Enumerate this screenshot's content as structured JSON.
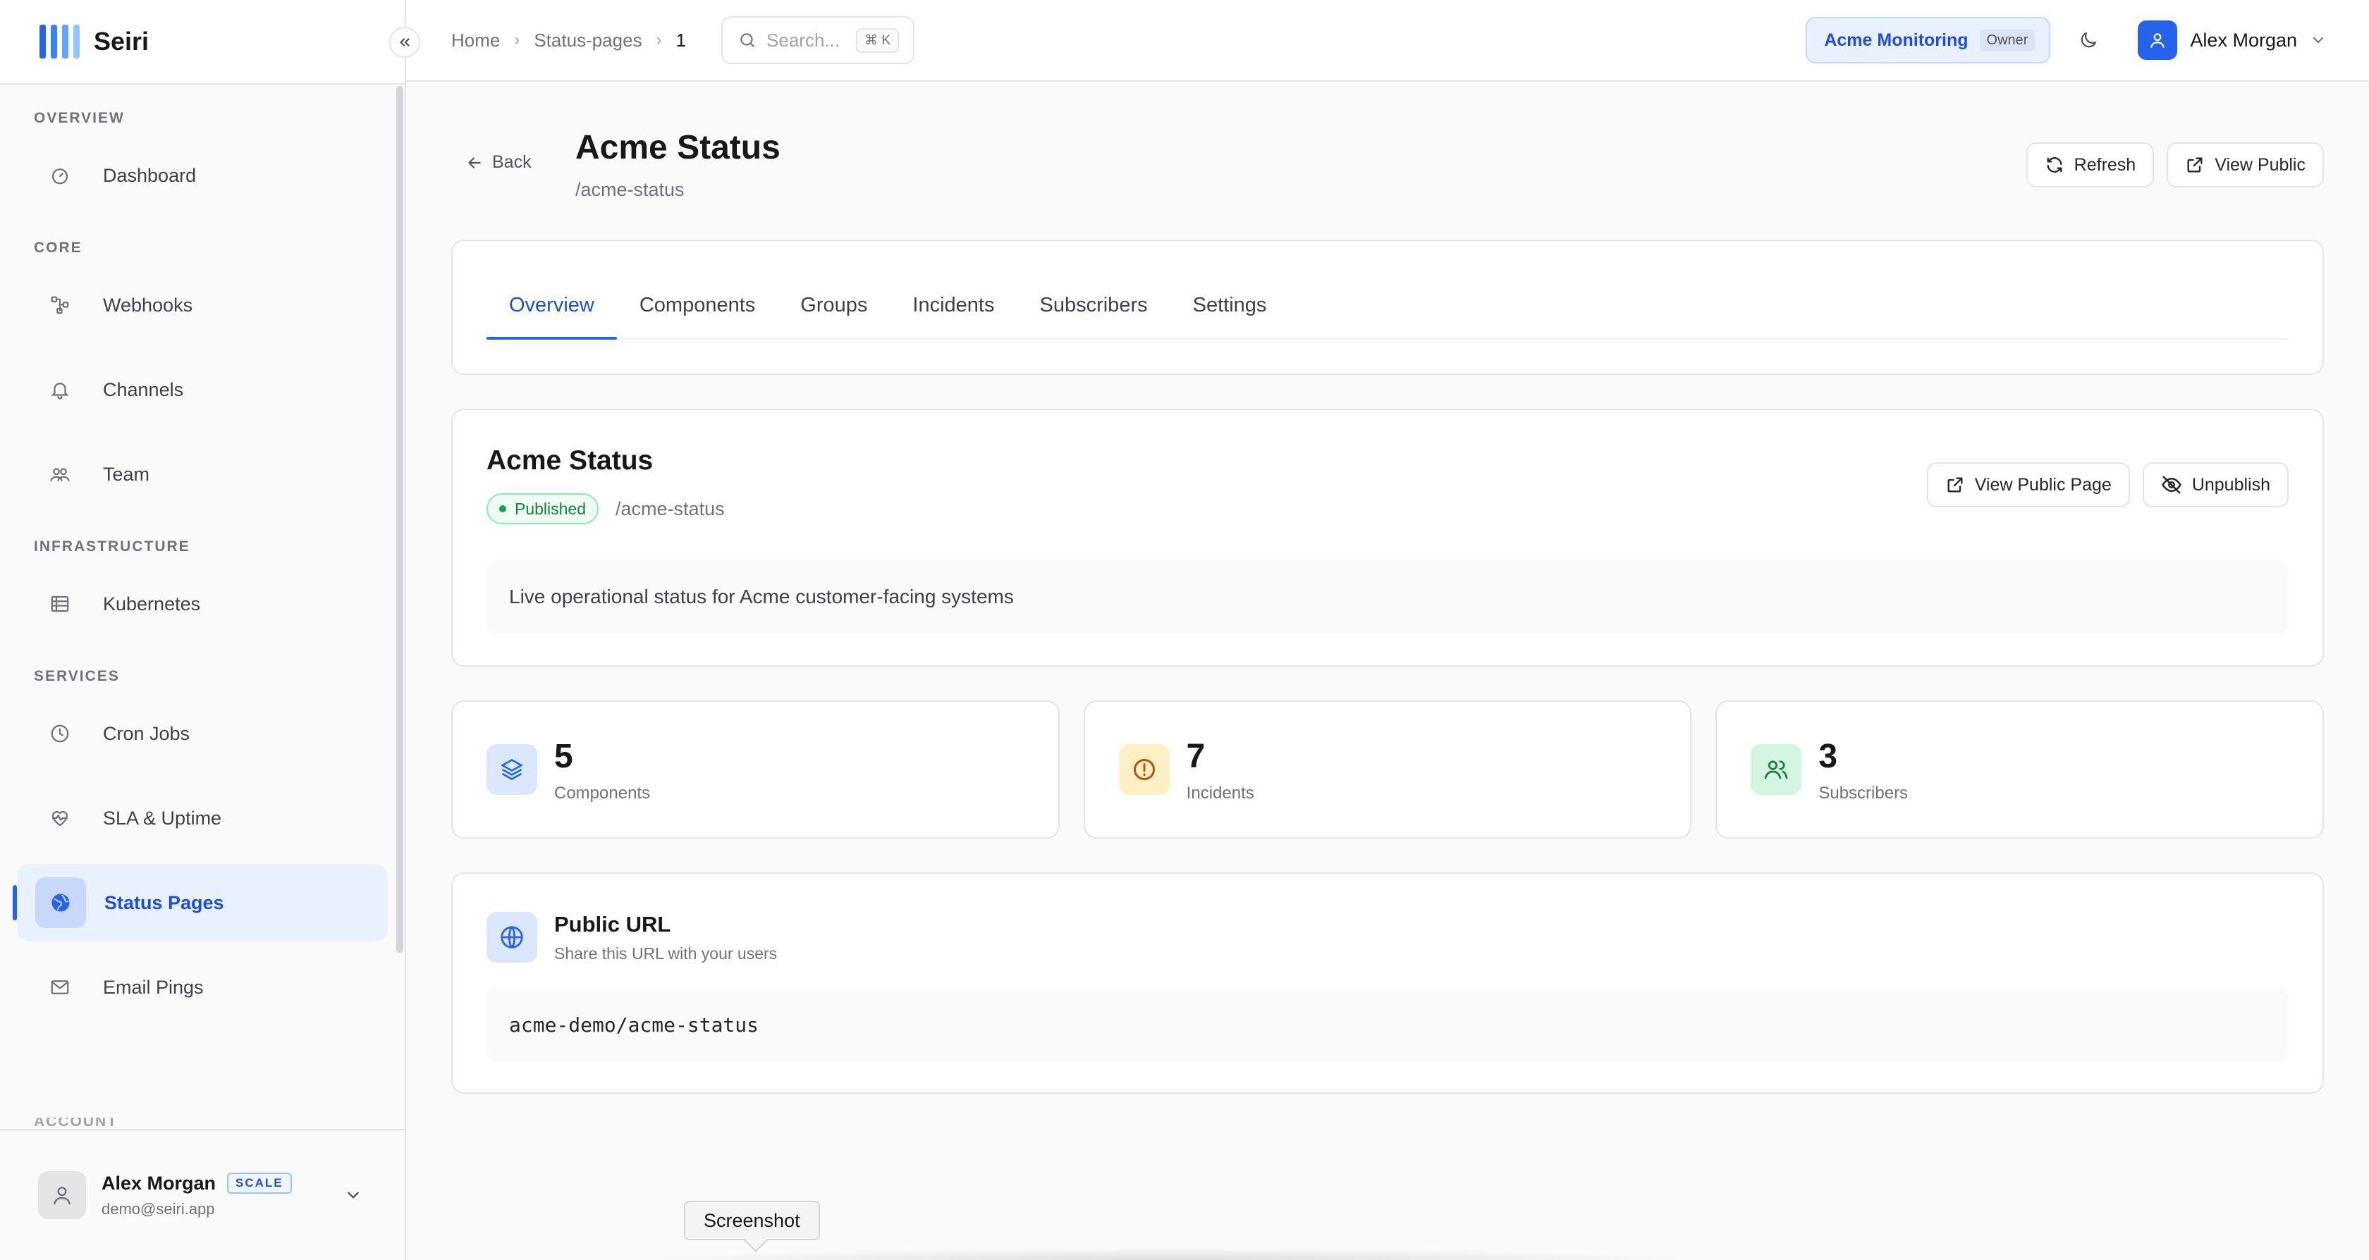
{
  "brand": {
    "name": "Seiri"
  },
  "sidebar": {
    "sections": [
      {
        "title": "OVERVIEW",
        "items": [
          {
            "label": "Dashboard",
            "icon": "gauge-icon"
          }
        ]
      },
      {
        "title": "CORE",
        "items": [
          {
            "label": "Webhooks",
            "icon": "webhook-icon"
          },
          {
            "label": "Channels",
            "icon": "bell-icon"
          },
          {
            "label": "Team",
            "icon": "team-icon"
          }
        ]
      },
      {
        "title": "INFRASTRUCTURE",
        "items": [
          {
            "label": "Kubernetes",
            "icon": "server-list-icon"
          }
        ]
      },
      {
        "title": "SERVICES",
        "items": [
          {
            "label": "Cron Jobs",
            "icon": "clock-icon"
          },
          {
            "label": "SLA & Uptime",
            "icon": "heart-pulse-icon"
          },
          {
            "label": "Status Pages",
            "icon": "globe-icon",
            "active": true
          },
          {
            "label": "Email Pings",
            "icon": "mail-icon"
          }
        ]
      }
    ],
    "next_section_partial": "ACCOUNT",
    "user": {
      "name": "Alex Morgan",
      "plan": "SCALE",
      "email": "demo@seiri.app"
    }
  },
  "topbar": {
    "breadcrumbs": [
      "Home",
      "Status-pages",
      "1"
    ],
    "search": {
      "placeholder": "Search...",
      "shortcut": "⌘ K"
    },
    "org": {
      "name": "Acme Monitoring",
      "role": "Owner"
    },
    "account_name": "Alex Morgan"
  },
  "page": {
    "back_label": "Back",
    "title": "Acme Status",
    "slug": "/acme-status",
    "refresh_label": "Refresh",
    "view_public_label": "View Public"
  },
  "tabs": [
    "Overview",
    "Components",
    "Groups",
    "Incidents",
    "Subscribers",
    "Settings"
  ],
  "active_tab": "Overview",
  "summary": {
    "title": "Acme Status",
    "status": "Published",
    "slug": "/acme-status",
    "view_public_page_label": "View Public Page",
    "unpublish_label": "Unpublish",
    "description": "Live operational status for Acme customer-facing systems"
  },
  "stats": [
    {
      "value": "5",
      "label": "Components",
      "icon": "layers-icon",
      "color": "#2563eb",
      "bg": "#dbe7fd"
    },
    {
      "value": "7",
      "label": "Incidents",
      "icon": "alert-circle-icon",
      "color": "#b45309",
      "bg": "#fdf0c4"
    },
    {
      "value": "3",
      "label": "Subscribers",
      "icon": "users-icon",
      "color": "#15803d",
      "bg": "#d3f5e1"
    }
  ],
  "public_url": {
    "title": "Public URL",
    "subtitle": "Share this URL with your users",
    "url": "acme-demo/acme-status"
  },
  "tooltip": {
    "label": "Screenshot"
  },
  "colors": {
    "accent": "#2563eb",
    "published": "#16a34a"
  }
}
